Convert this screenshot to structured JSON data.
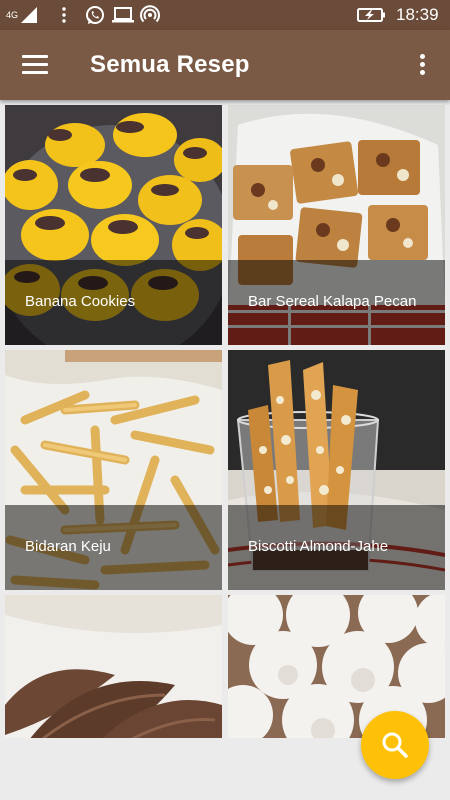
{
  "status_bar": {
    "network_label": "4G",
    "time": "18:39",
    "icons": [
      "signal-icon",
      "more-vert-icon",
      "whatsapp-icon",
      "laptop-icon",
      "hotspot-icon",
      "battery-charging-icon"
    ]
  },
  "app_bar": {
    "title": "Semua Resep",
    "menu_icon": "hamburger-menu-icon",
    "overflow_icon": "more-vert-icon"
  },
  "recipes": [
    {
      "label": "Banana Cookies",
      "image": "banana-cookies-photo"
    },
    {
      "label": "Bar Sereal Kalapa Pecan",
      "image": "cereal-bar-photo"
    },
    {
      "label": "Bidaran Keju",
      "image": "cheese-sticks-photo"
    },
    {
      "label": "Biscotti Almond-Jahe",
      "image": "biscotti-photo"
    },
    {
      "label": "",
      "image": "chocolate-cookies-photo"
    },
    {
      "label": "",
      "image": "snowball-cookies-photo"
    }
  ],
  "fab": {
    "icon": "search-icon"
  },
  "colors": {
    "status_bar": "#6b4c3a",
    "app_bar": "#7b5a45",
    "fab": "#ffc107",
    "background": "#ebebeb"
  }
}
